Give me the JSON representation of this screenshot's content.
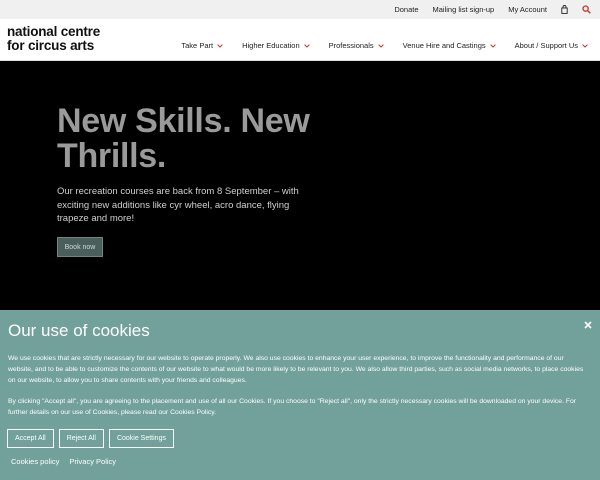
{
  "utility_bar": {
    "donate": "Donate",
    "mailing_list": "Mailing list sign-up",
    "account": "My Account"
  },
  "logo": {
    "line1": "national centre",
    "line2": "for circus arts"
  },
  "nav": {
    "items": [
      {
        "label": "Take Part"
      },
      {
        "label": "Higher Education"
      },
      {
        "label": "Professionals"
      },
      {
        "label": "Venue Hire and Castings"
      },
      {
        "label": "About / Support Us"
      }
    ]
  },
  "hero": {
    "title": "New Skills. New Thrills.",
    "text": "Our recreation courses are back from 8 September – with exciting new additions like cyr wheel, acro dance, flying trapeze and more!",
    "button": "Book now"
  },
  "cookie": {
    "title": "Our use of cookies",
    "paragraph1": "We use cookies that are strictly necessary for our website to operate properly. We also use cookies to enhance your user experience, to improve the functionality and performance of our website, and to be able to customize the contents of our website to what would be more likely to be relevant to you. We also allow third parties, such as social media networks, to place cookies on our website, to allow you to share contents with your friends and colleagues.",
    "paragraph2": "By clicking \"Accept all\", you are agreeing to the placement and use of all our Cookies. If you choose to \"Reject all\", only the strictly necessary cookies will be downloaded on your device. For further details on our use of Cookies, please read our Cookies Policy.",
    "accept_all": "Accept All",
    "reject_all": "Reject All",
    "settings": "Cookie Settings",
    "policy_link": "Cookies policy",
    "privacy_link": "Privacy Policy"
  },
  "colors": {
    "cookie_bg": "#72a09a",
    "hero_button": "#4a5f5b",
    "nav_chevron": "#c0392b",
    "search_icon": "#c0392b"
  }
}
